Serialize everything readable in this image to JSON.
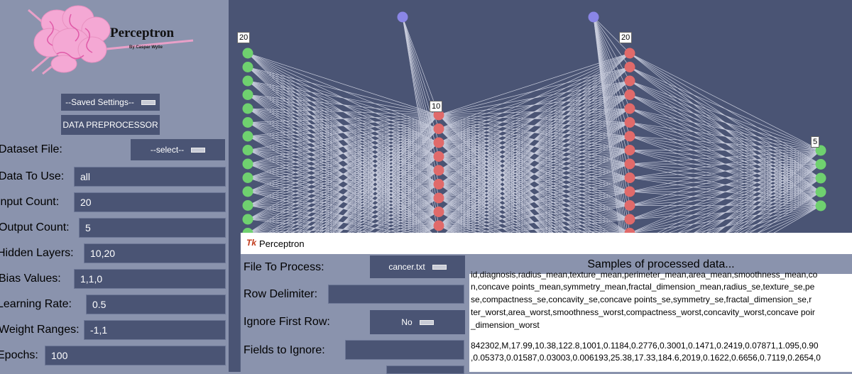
{
  "logo": {
    "title": "Perceptron",
    "subtitle": "By Caspar Wylie"
  },
  "saved_settings": "--Saved Settings--",
  "data_preprocessor": "DATA PREPROCESSOR",
  "form": [
    {
      "label": "Dataset File:",
      "value": "--select--",
      "type": "dropdown"
    },
    {
      "label": "Data To Use:",
      "value": "all",
      "type": "input"
    },
    {
      "label": "Input Count:",
      "value": "20",
      "type": "input"
    },
    {
      "label": "Output Count:",
      "value": "5",
      "type": "input"
    },
    {
      "label": "Hidden Layers:",
      "value": "10,20",
      "type": "input"
    },
    {
      "label": "Bias Values:",
      "value": "1,1,0",
      "type": "input"
    },
    {
      "label": "Learning Rate:",
      "value": "0.5",
      "type": "input"
    },
    {
      "label": "Weight Ranges:",
      "value": "-1,1",
      "type": "input"
    },
    {
      "label": "Epochs:",
      "value": "100",
      "type": "input"
    }
  ],
  "network": {
    "layers": [
      {
        "label": "20",
        "neurons": 20,
        "color": "#6fd16f"
      },
      {
        "label": "10",
        "neurons": 10,
        "color": "#e06a6a"
      },
      {
        "label": "20",
        "neurons": 20,
        "color": "#e06a6a"
      },
      {
        "label": "5",
        "neurons": 5,
        "color": "#6fd16f"
      }
    ],
    "bias_color": "#8a86e6",
    "line_color": "#c8ccdc"
  },
  "popup": {
    "title": "Perceptron",
    "file_to_process_label": "File To Process:",
    "file_to_process_value": "cancer.txt",
    "row_delimiter_label": "Row Delimiter:",
    "row_delimiter_value": "",
    "ignore_first_row_label": "Ignore First Row:",
    "ignore_first_row_value": "No",
    "fields_to_ignore_label": "Fields to Ignore:",
    "fields_to_ignore_value": "",
    "samples_title": "Samples of processed data...",
    "sample_lines": [
      "id,diagnosis,radius_mean,texture_mean,perimeter_mean,area_mean,smoothness_mean,co",
      "n,concave points_mean,symmetry_mean,fractal_dimension_mean,radius_se,texture_se,pe",
      "se,compactness_se,concavity_se,concave points_se,symmetry_se,fractal_dimension_se,r",
      "ter_worst,area_worst,smoothness_worst,compactness_worst,concavity_worst,concave poir",
      "_dimension_worst",
      "842302,M,17.99,10.38,122.8,1001,0.1184,0.2776,0.3001,0.1471,0.2419,0.07871,1.095,0.90",
      ",0.05373,0.01587,0.03003,0.006193,25.38,17.33,184.6,2019,0.1622,0.6656,0.7119,0.2654,0"
    ]
  }
}
